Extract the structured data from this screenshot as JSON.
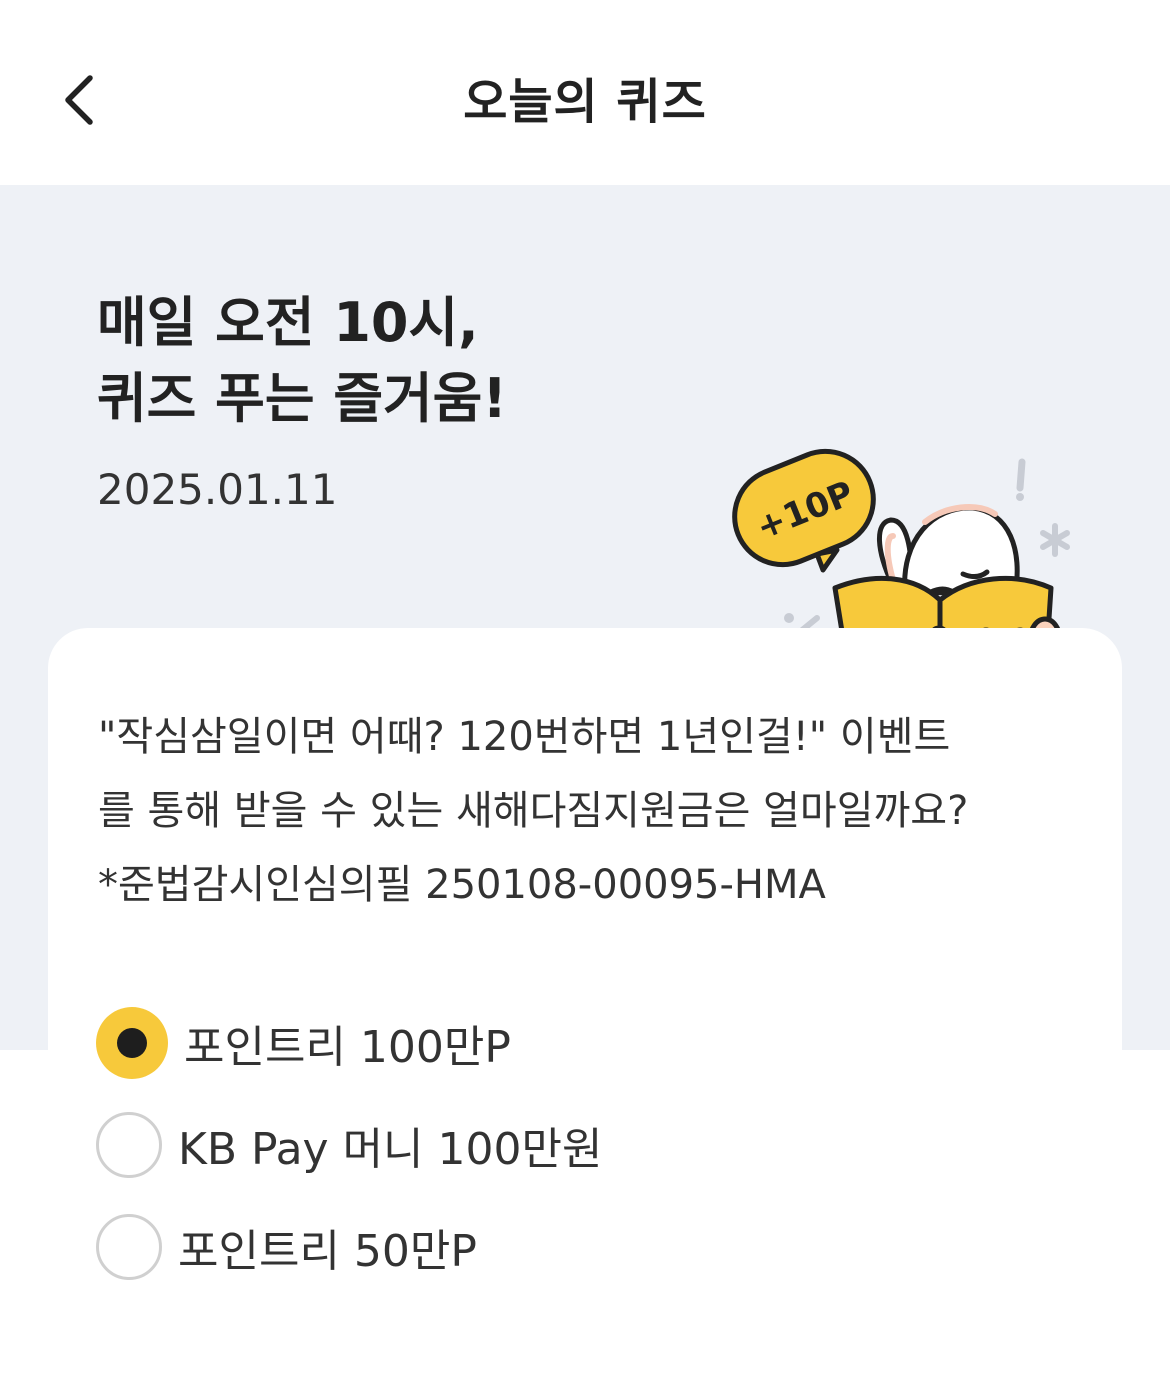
{
  "header": {
    "title": "오늘의 퀴즈",
    "back_icon": "chevron-left-icon"
  },
  "hero": {
    "headline_line1": "매일 오전 10시,",
    "headline_line2": "퀴즈 푸는 즐거움!",
    "date": "2025.01.11",
    "badge_text": "+10P",
    "accent_color": "#f7c93b"
  },
  "quiz": {
    "question_line1": "\"작심삼일이면 어때? 120번하면 1년인걸!\" 이벤트",
    "question_line2": "를 통해 받을 수 있는 새해다짐지원금은 얼마일까요?",
    "question_line3": "*준법감시인심의필 250108-00095-HMA",
    "options": [
      {
        "label": "포인트리 100만P",
        "selected": true
      },
      {
        "label": "KB Pay 머니 100만원",
        "selected": false
      },
      {
        "label": "포인트리 50만P",
        "selected": false
      }
    ]
  }
}
